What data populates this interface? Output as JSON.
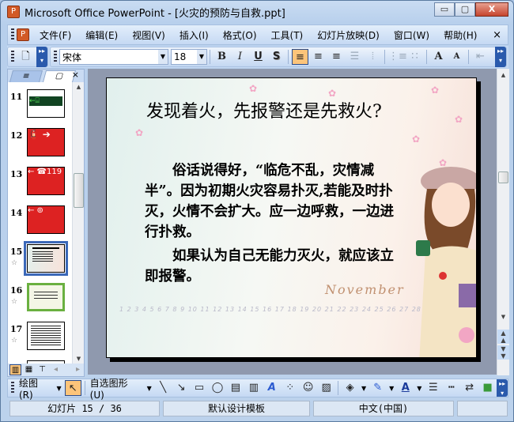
{
  "window": {
    "title": "Microsoft Office PowerPoint - [火灾的预防与自救.ppt]",
    "minimize": "▭",
    "restore": "▢",
    "close": "X"
  },
  "menu": [
    "文件(F)",
    "编辑(E)",
    "视图(V)",
    "插入(I)",
    "格式(O)",
    "工具(T)",
    "幻灯片放映(D)",
    "窗口(W)",
    "帮助(H)"
  ],
  "menu_close": "×",
  "format_toolbar": {
    "font": "宋体",
    "size": "18",
    "bold": "B",
    "italic": "I",
    "underline": "U",
    "shadow": "S",
    "grow": "A",
    "shrink": "A"
  },
  "pane": {
    "tab_outline": "≡",
    "tab_slides": "▢",
    "close": "×"
  },
  "thumbnails": [
    {
      "num": "11",
      "star": ""
    },
    {
      "num": "12",
      "star": ""
    },
    {
      "num": "13",
      "star": ""
    },
    {
      "num": "14",
      "star": ""
    },
    {
      "num": "15",
      "star": "☆"
    },
    {
      "num": "16",
      "star": "☆"
    },
    {
      "num": "17",
      "star": "☆"
    }
  ],
  "selected_slide": 15,
  "slide": {
    "title": "发现着火，先报警还是先救火?",
    "para1": "俗话说得好，“临危不乱，灾情减半”。因为初期火灾容易扑灭,若能及时扑灭，火情不会扩大。应一边呼救，一边进行扑救。",
    "para2": "如果认为自己无能力灭火，就应该立即报警。",
    "month": "November",
    "calendar": "1 2 3 4 5 6 7 8 9 10 11 12 13 14 15 16 17 18 19 20 21 22 23 24 25 26 27 28 29 30"
  },
  "drawing_toolbar": {
    "draw": "绘图(R)",
    "autoshapes": "自选图形(U)"
  },
  "status": {
    "slide": "幻灯片 15 / 36",
    "template": "默认设计模板",
    "language": "中文(中国)"
  },
  "colors": {
    "accent": "#fcc47a",
    "toolbar": "#c5d9f3",
    "workspace": "#8f99ae",
    "selection": "#3b68b8"
  }
}
